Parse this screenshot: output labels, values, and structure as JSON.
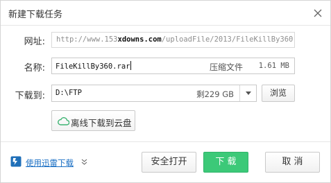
{
  "dialog": {
    "title": "新建下载任务"
  },
  "form": {
    "url_label": "网址:",
    "url_prefix": "http://www.153",
    "url_highlight": "xdowns.com",
    "url_suffix": "/uploadFile/2013/FileKillBy360.",
    "name_label": "名称:",
    "name_value": "FileKillBy360.rar",
    "file_type": "压缩文件",
    "file_size": "1.61 MB",
    "path_label": "下载到:",
    "path_value": "D:\\FTP",
    "free_space": "剩229 GB",
    "browse_label": "浏览",
    "cloud_button_label": "离线下载到云盘"
  },
  "footer": {
    "xunlei_link": "使用迅雷下载",
    "open_label": "安全打开",
    "download_label": "下 载",
    "cancel_label": "取 消"
  },
  "colors": {
    "primary_green": "#3cc978",
    "link_blue": "#1a6fc4",
    "cloud_green": "#3cb371"
  },
  "icons": {
    "close": "close-icon",
    "dropdown": "chevron-down-icon",
    "cloud": "cloud-icon",
    "xunlei": "xunlei-logo-icon",
    "expand": "double-chevron-down-icon"
  }
}
